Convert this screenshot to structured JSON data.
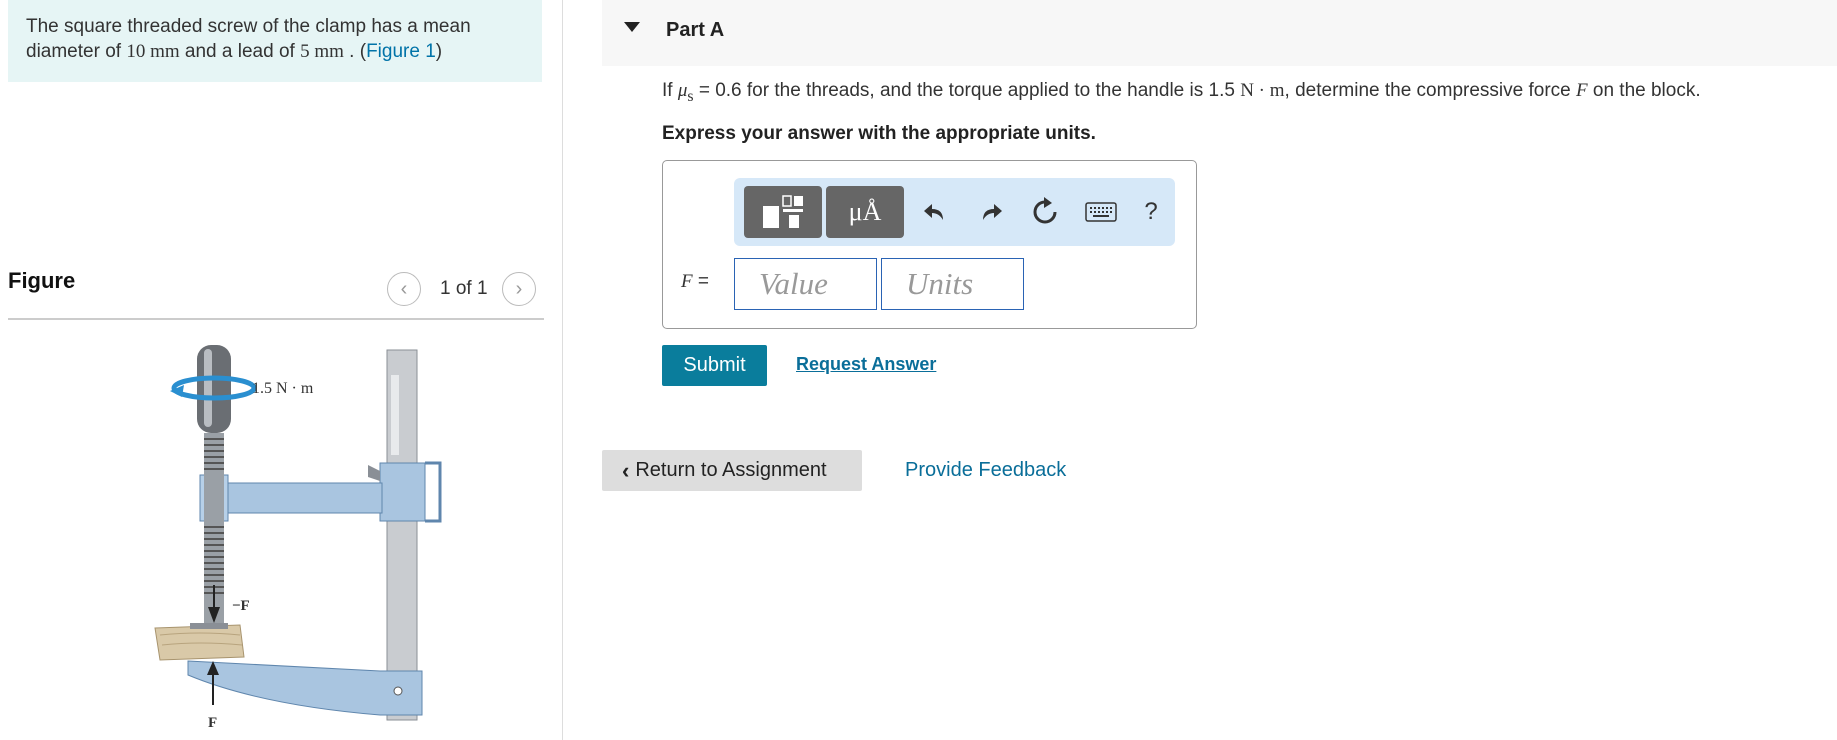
{
  "intro": {
    "text_1": "The square threaded screw of the clamp has a mean diameter of ",
    "diameter": "10 mm",
    "text_2": " and a lead of ",
    "lead": "5 mm",
    "text_3": " . (",
    "figure_link": "Figure 1",
    "text_4": ")"
  },
  "figure": {
    "title": "Figure",
    "count": "1 of 1",
    "torque_label": "1.5 N · m",
    "minus_f_label": "−F",
    "f_label": "F"
  },
  "part": {
    "title": "Part A",
    "question_1": "If ",
    "mu": "μ",
    "mu_sub": "s",
    "question_2": " = 0.6 for the threads, and the torque applied to the handle is 1.5 ",
    "torque_unit": "N · m",
    "question_3": ", determine the compressive force ",
    "force_var": "F",
    "question_4": " on the block.",
    "instruction": "Express your answer with the appropriate units."
  },
  "toolbar": {
    "units_label": "μÅ",
    "help_label": "?",
    "icons": [
      "templates-icon",
      "units-icon",
      "undo-icon",
      "redo-icon",
      "reset-icon",
      "keyboard-icon",
      "help-icon"
    ]
  },
  "answer": {
    "variable": "F",
    "equals": " =",
    "value_placeholder": "Value",
    "units_placeholder": "Units"
  },
  "actions": {
    "submit": "Submit",
    "request": "Request Answer",
    "return": "Return to Assignment",
    "feedback": "Provide Feedback"
  },
  "colors": {
    "intro_bg": "#e6f5f5",
    "accent": "#0a7d9c",
    "link": "#0a6e99",
    "toolbar_bg": "#d6e8f8",
    "input_border": "#2a63b4"
  }
}
